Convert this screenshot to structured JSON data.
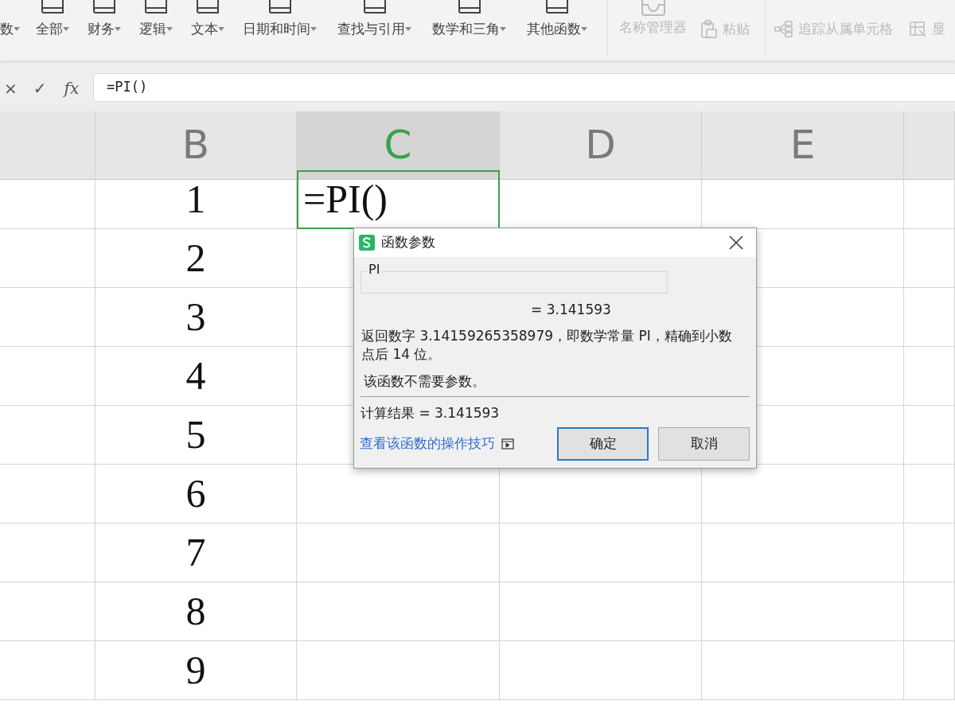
{
  "toolbar": {
    "categories": [
      {
        "label": "数"
      },
      {
        "label": "全部"
      },
      {
        "label": "财务"
      },
      {
        "label": "逻辑"
      },
      {
        "label": "文本"
      },
      {
        "label": "日期和时间"
      },
      {
        "label": "查找与引用"
      },
      {
        "label": "数学和三角"
      },
      {
        "label": "其他函数"
      }
    ],
    "tools": [
      {
        "label": "名称管理器",
        "kind": "large",
        "disabled": true
      },
      {
        "label": "粘贴",
        "kind": "paste",
        "disabled": true
      },
      {
        "label": "追踪从属单元格",
        "kind": "trace",
        "disabled": true
      },
      {
        "label": "显",
        "kind": "show",
        "disabled": true
      }
    ]
  },
  "formula_bar": {
    "cancel": "×",
    "confirm": "✓",
    "fx": "fx",
    "value": "=PI()"
  },
  "sheet": {
    "columns": [
      {
        "label": "B",
        "selected": false
      },
      {
        "label": "C",
        "selected": true
      },
      {
        "label": "D",
        "selected": false
      },
      {
        "label": "E",
        "selected": false
      }
    ],
    "rows": [
      {
        "col_b": "1",
        "col_c": "=PI()",
        "col_c_selected": true
      },
      {
        "col_b": "2",
        "col_c_selected": false
      },
      {
        "col_b": "3",
        "col_c_selected": false
      },
      {
        "col_b": "4",
        "col_c_selected": false
      },
      {
        "col_b": "5",
        "col_c_selected": false
      },
      {
        "col_b": "6",
        "col_c_selected": false
      },
      {
        "col_b": "7",
        "col_c_selected": false
      },
      {
        "col_b": "8",
        "col_c_selected": false
      },
      {
        "col_b": "9",
        "col_c_selected": false
      }
    ]
  },
  "dialog": {
    "title": "函数参数",
    "function_name": "PI",
    "result_preview": "= 3.141593",
    "description": "返回数字 3.14159265358979，即数学常量 PI，精确到小数点后 14 位。",
    "note": "该函数不需要参数。",
    "calc_result": "计算结果 = 3.141593",
    "help_link": "查看该函数的操作技巧",
    "buttons": [
      {
        "label": "确定",
        "default": true
      },
      {
        "label": "取消",
        "default": false
      }
    ]
  }
}
